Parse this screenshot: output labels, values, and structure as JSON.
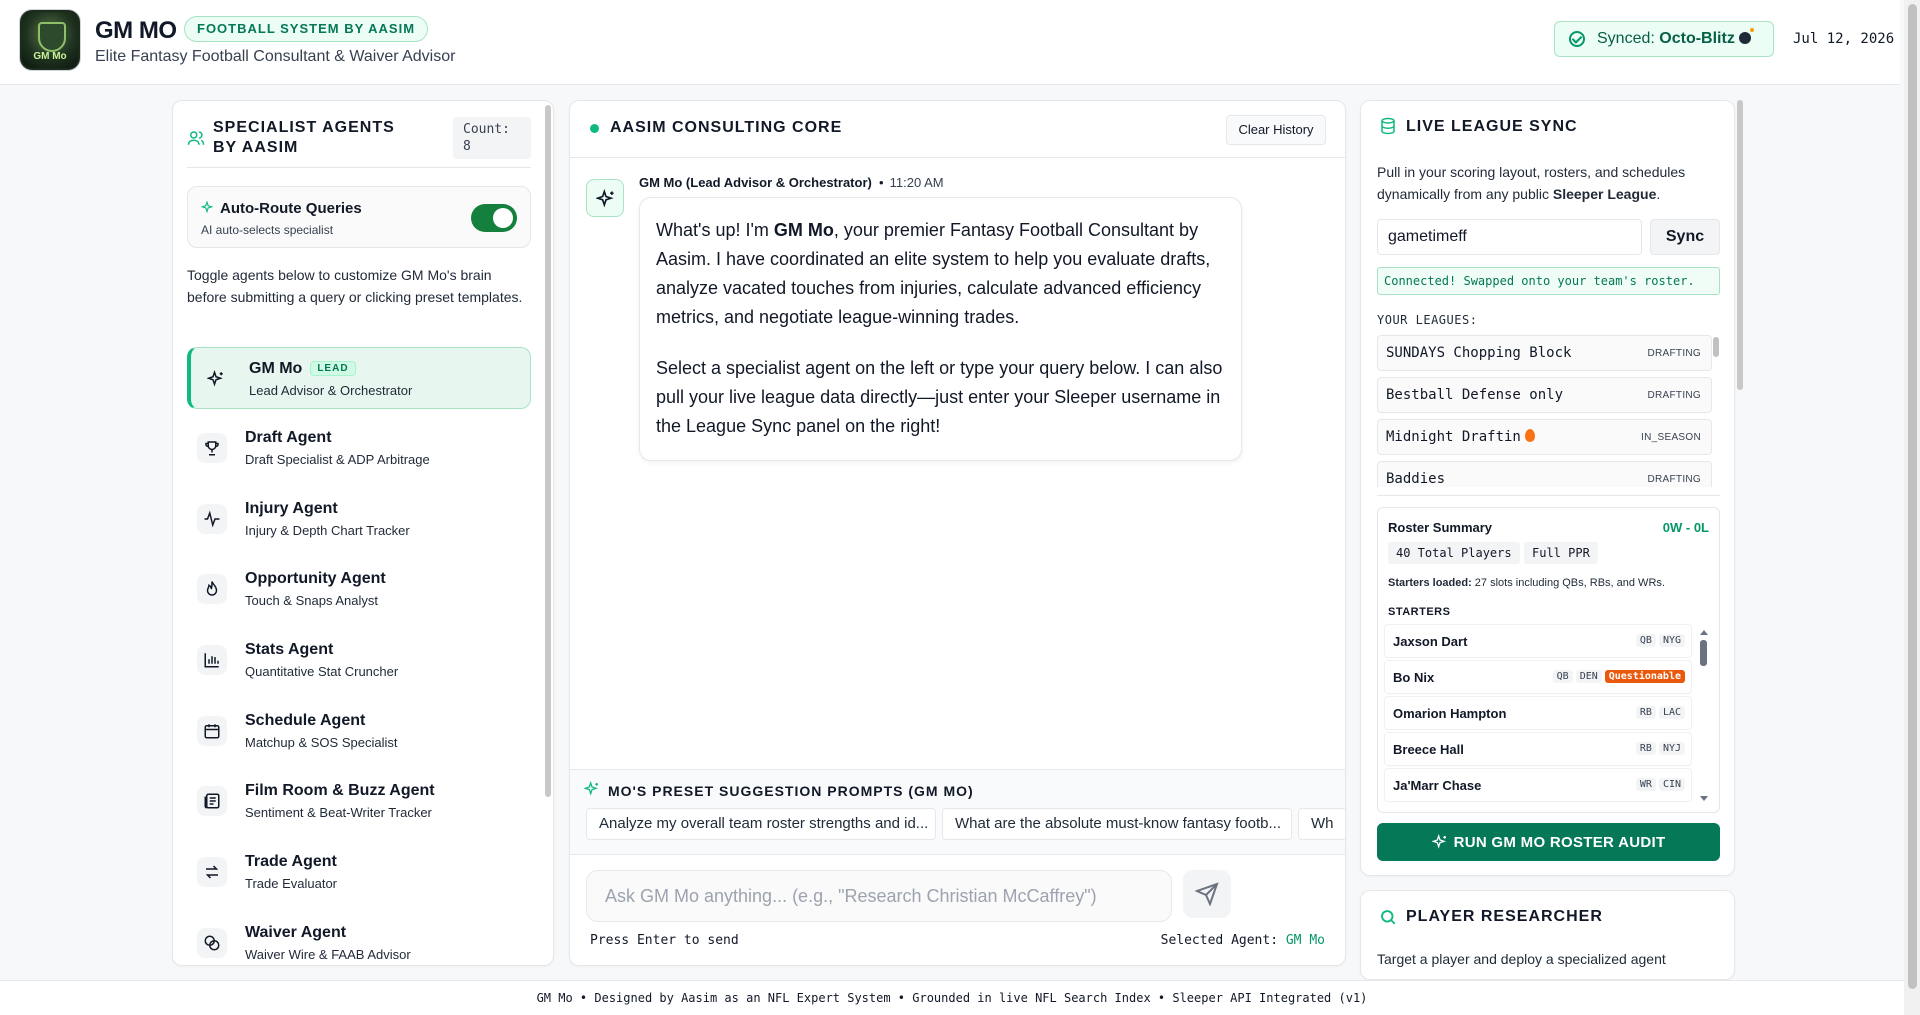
{
  "header": {
    "title": "GM MO",
    "badge": "FOOTBALL SYSTEM BY AASIM",
    "subtitle": "Elite Fantasy Football Consultant & Waiver Advisor",
    "logo_text": "GM Mo",
    "synced_label": "Synced: ",
    "synced_league": "Octo-Blitz",
    "date": "Jul 12, 2026"
  },
  "left": {
    "title": "SPECIALIST AGENTS BY AASIM",
    "count": "Count: 8",
    "auto_route_label": "Auto-Route Queries",
    "auto_route_sub": "AI auto-selects specialist",
    "auto_route_on": true,
    "intro": "Toggle agents below to customize GM Mo's brain before submitting a query or clicking preset templates.",
    "agents": [
      {
        "name": "GM Mo",
        "desc": "Lead Advisor & Orchestrator",
        "tag": "LEAD",
        "icon": "sparkles-icon"
      },
      {
        "name": "Draft Agent",
        "desc": "Draft Specialist & ADP Arbitrage",
        "icon": "trophy-icon"
      },
      {
        "name": "Injury Agent",
        "desc": "Injury & Depth Chart Tracker",
        "icon": "pulse-icon"
      },
      {
        "name": "Opportunity Agent",
        "desc": "Touch & Snaps Analyst",
        "icon": "flame-icon"
      },
      {
        "name": "Stats Agent",
        "desc": "Quantitative Stat Cruncher",
        "icon": "bar-chart-icon"
      },
      {
        "name": "Schedule Agent",
        "desc": "Matchup & SOS Specialist",
        "icon": "calendar-icon"
      },
      {
        "name": "Film Room & Buzz Agent",
        "desc": "Sentiment & Beat-Writer Tracker",
        "icon": "newspaper-icon"
      },
      {
        "name": "Trade Agent",
        "desc": "Trade Evaluator",
        "icon": "swap-icon"
      },
      {
        "name": "Waiver Agent",
        "desc": "Waiver Wire & FAAB Advisor",
        "icon": "coins-icon"
      }
    ]
  },
  "center": {
    "title": "AASIM CONSULTING CORE",
    "clear_label": "Clear History",
    "message": {
      "author": "GM Mo (Lead Advisor & Orchestrator)",
      "time": "11:20 AM",
      "p1_pre": "What's up! I'm ",
      "p1_bold": "GM Mo",
      "p1_post": ", your premier Fantasy Football Consultant by Aasim. I have coordinated an elite system to help you evaluate drafts, analyze vacated touches from injuries, calculate advanced efficiency metrics, and negotiate league-winning trades.",
      "p2": "Select a specialist agent on the left or type your query below. I can also pull your live league data directly—just enter your Sleeper username in the League Sync panel on the right!"
    },
    "presets_title": "MO'S PRESET SUGGESTION PROMPTS (GM MO)",
    "presets": [
      "Analyze my overall team roster strengths and id...",
      "What are the absolute must-know fantasy footb...",
      "Wh"
    ],
    "input_placeholder": "Ask GM Mo anything... (e.g., \"Research Christian McCaffrey\")",
    "hint": "Press Enter to send",
    "selected_label": "Selected Agent: ",
    "selected_agent": "GM Mo"
  },
  "right": {
    "sync_title": "LIVE LEAGUE SYNC",
    "sync_desc_pre": "Pull in your scoring layout, rosters, and schedules dynamically from any public ",
    "sync_desc_bold": "Sleeper League",
    "sync_desc_post": ".",
    "username": "gametimeff",
    "sync_button": "Sync",
    "connected": "Connected! Swapped onto your team's roster.",
    "leagues_label": "YOUR LEAGUES:",
    "leagues": [
      {
        "name": "SUNDAYS Chopping Block",
        "status": "DRAFTING"
      },
      {
        "name": "Bestball Defense only",
        "status": "DRAFTING"
      },
      {
        "name": "Midnight Draftin",
        "status": "IN_SEASON",
        "flame": true
      },
      {
        "name": "Baddies",
        "status": "DRAFTING"
      }
    ],
    "roster": {
      "title": "Roster Summary",
      "record": "0W - 0L",
      "total_players": "40 Total Players",
      "scoring": "Full PPR",
      "starters_loaded_label": "Starters loaded:",
      "starters_loaded_text": " 27 slots including QBs, RBs, and WRs.",
      "starters_heading": "STARTERS",
      "players": [
        {
          "name": "Jaxson Dart",
          "pos": "QB",
          "team": "NYG"
        },
        {
          "name": "Bo Nix",
          "pos": "QB",
          "team": "DEN",
          "status": "Questionable"
        },
        {
          "name": "Omarion Hampton",
          "pos": "RB",
          "team": "LAC"
        },
        {
          "name": "Breece Hall",
          "pos": "RB",
          "team": "NYJ"
        },
        {
          "name": "Ja'Marr Chase",
          "pos": "WR",
          "team": "CIN"
        }
      ]
    },
    "audit_button": "RUN GM MO ROSTER AUDIT",
    "researcher_title": "PLAYER RESEARCHER",
    "researcher_desc": "Target a player and deploy a specialized agent"
  },
  "footer": "GM Mo • Designed by Aasim as an NFL Expert System • Grounded in live NFL Search Index • Sleeper API Integrated (v1)",
  "colors": {
    "accent": "#047857",
    "accent_light": "#ecfdf5",
    "live": "#10b981",
    "warning": "#ea580c"
  }
}
